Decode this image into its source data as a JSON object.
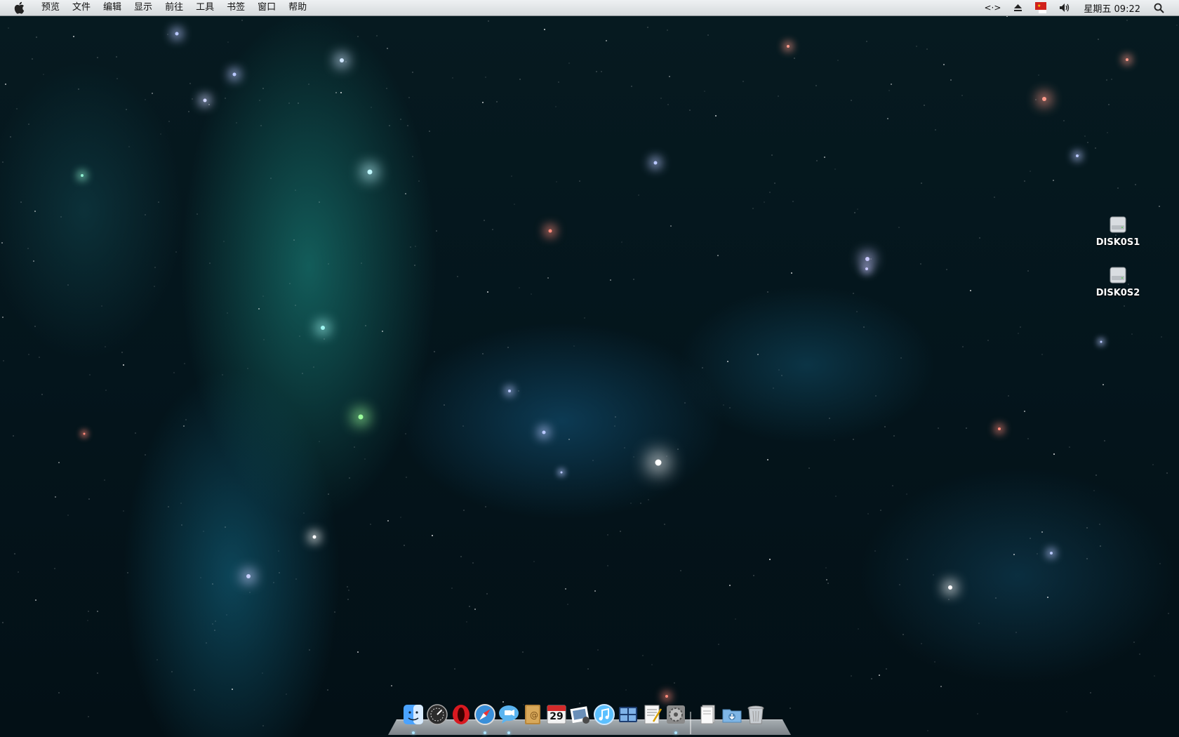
{
  "menubar": {
    "apple_icon": "apple-icon",
    "menus": [
      "预览",
      "文件",
      "编辑",
      "显示",
      "前往",
      "工具",
      "书签",
      "窗口",
      "帮助"
    ],
    "status": {
      "remote": "<·>",
      "eject_icon": "eject-icon",
      "flag_icon": "flag-input-icon",
      "volume_icon": "volume-icon",
      "clock": "星期五 09:22",
      "search_icon": "spotlight-search-icon"
    }
  },
  "desktop": {
    "disks": [
      {
        "label": "DISK0S1",
        "icon": "hard-disk-icon"
      },
      {
        "label": "DISK0S2",
        "icon": "hard-disk-icon"
      }
    ]
  },
  "dock": {
    "calendar_day": "29",
    "items": [
      {
        "name": "finder",
        "color": "#4aa3ff"
      },
      {
        "name": "dashboard",
        "color": "#3a3a3a"
      },
      {
        "name": "opera",
        "color": "#d81920"
      },
      {
        "name": "safari",
        "color": "#3a8fd9"
      },
      {
        "name": "ichat",
        "color": "#5ab4f0"
      },
      {
        "name": "address-book",
        "color": "#b8863a"
      },
      {
        "name": "ical",
        "color": "#e8e8e8"
      },
      {
        "name": "iphoto",
        "color": "#6a8fb8"
      },
      {
        "name": "itunes",
        "color": "#5cc0ff"
      },
      {
        "name": "spaces",
        "color": "#2b5aa0"
      },
      {
        "name": "textedit",
        "color": "#f2f2f2"
      },
      {
        "name": "system-preferences",
        "color": "#8a8a8a"
      },
      {
        "name": "documents-stack",
        "color": "#e8e8e8"
      },
      {
        "name": "downloads-folder",
        "color": "#7fb6e6"
      },
      {
        "name": "trash",
        "color": "#c8cdd2"
      }
    ]
  }
}
